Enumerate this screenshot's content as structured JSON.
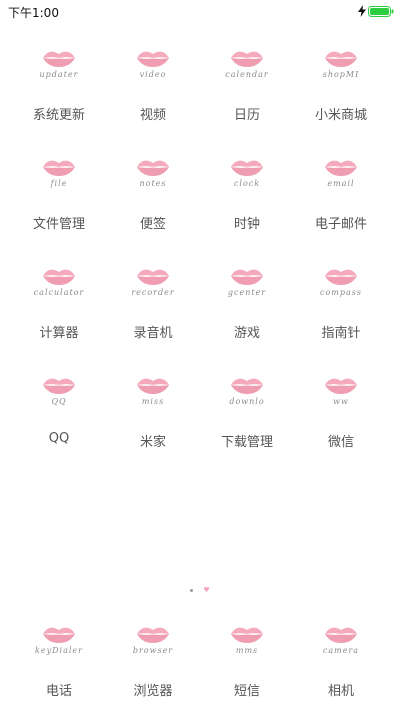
{
  "status": {
    "time": "下午1:00"
  },
  "apps": [
    {
      "icon_text": "updater",
      "label": "系统更新"
    },
    {
      "icon_text": "video",
      "label": "视频"
    },
    {
      "icon_text": "calendar",
      "label": "日历"
    },
    {
      "icon_text": "shopMI",
      "label": "小米商城"
    },
    {
      "icon_text": "file",
      "label": "文件管理"
    },
    {
      "icon_text": "notes",
      "label": "便签"
    },
    {
      "icon_text": "clock",
      "label": "时钟"
    },
    {
      "icon_text": "email",
      "label": "电子邮件"
    },
    {
      "icon_text": "calculator",
      "label": "计算器"
    },
    {
      "icon_text": "recorder",
      "label": "录音机"
    },
    {
      "icon_text": "gcenter",
      "label": "游戏"
    },
    {
      "icon_text": "compass",
      "label": "指南针"
    },
    {
      "icon_text": "QQ",
      "label": "QQ"
    },
    {
      "icon_text": "miss",
      "label": "米家"
    },
    {
      "icon_text": "downlo",
      "label": "下载管理"
    },
    {
      "icon_text": "ww",
      "label": "微信"
    }
  ],
  "dock": [
    {
      "icon_text": "keyDialer",
      "label": "电话"
    },
    {
      "icon_text": "browser",
      "label": "浏览器"
    },
    {
      "icon_text": "mms",
      "label": "短信"
    },
    {
      "icon_text": "camera",
      "label": "相机"
    }
  ],
  "icon_style": {
    "lip_color": "#f29bb0",
    "lip_shade": "#e87592"
  },
  "battery_color": "#2ecc40"
}
